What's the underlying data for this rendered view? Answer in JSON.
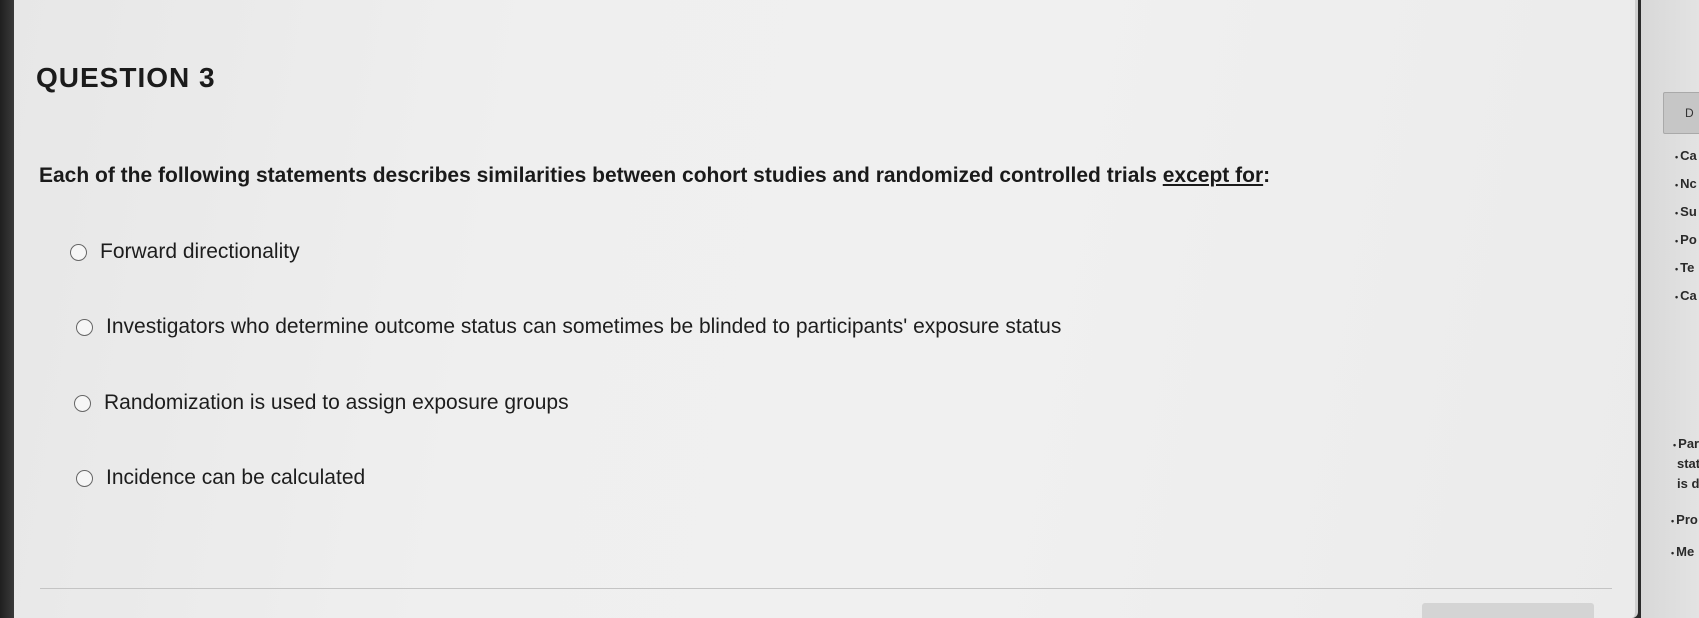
{
  "question": {
    "title": "QUESTION 3",
    "stem_text": "Each of the following statements describes similarities between cohort studies and randomized controlled trials ",
    "stem_emphasis": "except for",
    "stem_end": ":",
    "choices": [
      {
        "label": "Forward directionality",
        "selected": false
      },
      {
        "label": "Investigators who determine outcome status can sometimes be blinded to participants' exposure status",
        "selected": false
      },
      {
        "label": "Randomization is used to assign exposure groups",
        "selected": false
      },
      {
        "label": "Incidence can be calculated",
        "selected": false
      }
    ]
  },
  "sidebar": {
    "button_label": "D",
    "bullet": "•",
    "items": [
      "Ca",
      "Nc",
      "Su",
      "Po",
      "Te",
      "Ca",
      "Par",
      "stat",
      "is d",
      "Pro",
      "Me"
    ]
  }
}
